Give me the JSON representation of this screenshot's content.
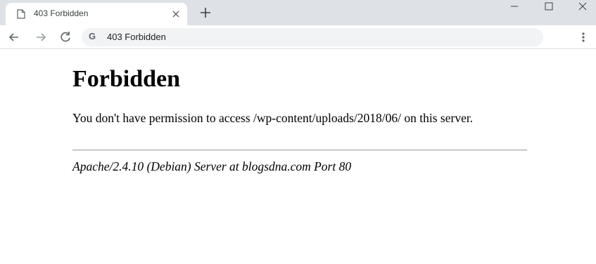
{
  "browser": {
    "tab": {
      "title": "403 Forbidden",
      "icon": "document-icon",
      "close_icon": "close-icon"
    },
    "new_tab_icon": "plus-icon",
    "window_controls": [
      "minimize-icon",
      "maximize-icon",
      "close-icon"
    ],
    "toolbar": {
      "back_icon": "arrow-left-icon",
      "forward_icon": "arrow-right-icon",
      "reload_icon": "reload-icon",
      "site_icon_letter": "G",
      "address_text": "403 Forbidden",
      "menu_icon": "kebab-menu-icon"
    },
    "colors": {
      "tabstrip": "#dee1e6",
      "omnibox": "#f1f3f4",
      "text": "#202124"
    }
  },
  "page": {
    "title": "Forbidden",
    "message": "You don't have permission to access /wp-content/uploads/2018/06/ on this server.",
    "footer": "Apache/2.4.10 (Debian) Server at blogsdna.com Port 80"
  }
}
